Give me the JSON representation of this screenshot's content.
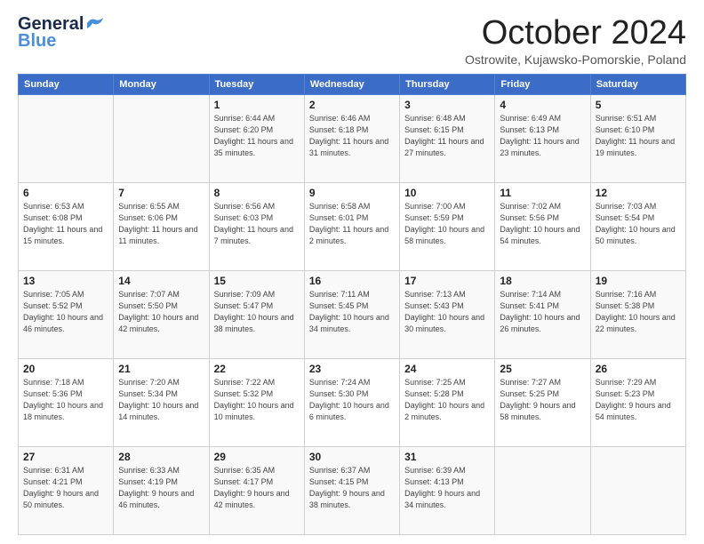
{
  "header": {
    "logo_line1": "General",
    "logo_line2": "Blue",
    "month": "October 2024",
    "location": "Ostrowite, Kujawsko-Pomorskie, Poland"
  },
  "weekdays": [
    "Sunday",
    "Monday",
    "Tuesday",
    "Wednesday",
    "Thursday",
    "Friday",
    "Saturday"
  ],
  "weeks": [
    [
      {
        "day": "",
        "sunrise": "",
        "sunset": "",
        "daylight": ""
      },
      {
        "day": "",
        "sunrise": "",
        "sunset": "",
        "daylight": ""
      },
      {
        "day": "1",
        "sunrise": "Sunrise: 6:44 AM",
        "sunset": "Sunset: 6:20 PM",
        "daylight": "Daylight: 11 hours and 35 minutes."
      },
      {
        "day": "2",
        "sunrise": "Sunrise: 6:46 AM",
        "sunset": "Sunset: 6:18 PM",
        "daylight": "Daylight: 11 hours and 31 minutes."
      },
      {
        "day": "3",
        "sunrise": "Sunrise: 6:48 AM",
        "sunset": "Sunset: 6:15 PM",
        "daylight": "Daylight: 11 hours and 27 minutes."
      },
      {
        "day": "4",
        "sunrise": "Sunrise: 6:49 AM",
        "sunset": "Sunset: 6:13 PM",
        "daylight": "Daylight: 11 hours and 23 minutes."
      },
      {
        "day": "5",
        "sunrise": "Sunrise: 6:51 AM",
        "sunset": "Sunset: 6:10 PM",
        "daylight": "Daylight: 11 hours and 19 minutes."
      }
    ],
    [
      {
        "day": "6",
        "sunrise": "Sunrise: 6:53 AM",
        "sunset": "Sunset: 6:08 PM",
        "daylight": "Daylight: 11 hours and 15 minutes."
      },
      {
        "day": "7",
        "sunrise": "Sunrise: 6:55 AM",
        "sunset": "Sunset: 6:06 PM",
        "daylight": "Daylight: 11 hours and 11 minutes."
      },
      {
        "day": "8",
        "sunrise": "Sunrise: 6:56 AM",
        "sunset": "Sunset: 6:03 PM",
        "daylight": "Daylight: 11 hours and 7 minutes."
      },
      {
        "day": "9",
        "sunrise": "Sunrise: 6:58 AM",
        "sunset": "Sunset: 6:01 PM",
        "daylight": "Daylight: 11 hours and 2 minutes."
      },
      {
        "day": "10",
        "sunrise": "Sunrise: 7:00 AM",
        "sunset": "Sunset: 5:59 PM",
        "daylight": "Daylight: 10 hours and 58 minutes."
      },
      {
        "day": "11",
        "sunrise": "Sunrise: 7:02 AM",
        "sunset": "Sunset: 5:56 PM",
        "daylight": "Daylight: 10 hours and 54 minutes."
      },
      {
        "day": "12",
        "sunrise": "Sunrise: 7:03 AM",
        "sunset": "Sunset: 5:54 PM",
        "daylight": "Daylight: 10 hours and 50 minutes."
      }
    ],
    [
      {
        "day": "13",
        "sunrise": "Sunrise: 7:05 AM",
        "sunset": "Sunset: 5:52 PM",
        "daylight": "Daylight: 10 hours and 46 minutes."
      },
      {
        "day": "14",
        "sunrise": "Sunrise: 7:07 AM",
        "sunset": "Sunset: 5:50 PM",
        "daylight": "Daylight: 10 hours and 42 minutes."
      },
      {
        "day": "15",
        "sunrise": "Sunrise: 7:09 AM",
        "sunset": "Sunset: 5:47 PM",
        "daylight": "Daylight: 10 hours and 38 minutes."
      },
      {
        "day": "16",
        "sunrise": "Sunrise: 7:11 AM",
        "sunset": "Sunset: 5:45 PM",
        "daylight": "Daylight: 10 hours and 34 minutes."
      },
      {
        "day": "17",
        "sunrise": "Sunrise: 7:13 AM",
        "sunset": "Sunset: 5:43 PM",
        "daylight": "Daylight: 10 hours and 30 minutes."
      },
      {
        "day": "18",
        "sunrise": "Sunrise: 7:14 AM",
        "sunset": "Sunset: 5:41 PM",
        "daylight": "Daylight: 10 hours and 26 minutes."
      },
      {
        "day": "19",
        "sunrise": "Sunrise: 7:16 AM",
        "sunset": "Sunset: 5:38 PM",
        "daylight": "Daylight: 10 hours and 22 minutes."
      }
    ],
    [
      {
        "day": "20",
        "sunrise": "Sunrise: 7:18 AM",
        "sunset": "Sunset: 5:36 PM",
        "daylight": "Daylight: 10 hours and 18 minutes."
      },
      {
        "day": "21",
        "sunrise": "Sunrise: 7:20 AM",
        "sunset": "Sunset: 5:34 PM",
        "daylight": "Daylight: 10 hours and 14 minutes."
      },
      {
        "day": "22",
        "sunrise": "Sunrise: 7:22 AM",
        "sunset": "Sunset: 5:32 PM",
        "daylight": "Daylight: 10 hours and 10 minutes."
      },
      {
        "day": "23",
        "sunrise": "Sunrise: 7:24 AM",
        "sunset": "Sunset: 5:30 PM",
        "daylight": "Daylight: 10 hours and 6 minutes."
      },
      {
        "day": "24",
        "sunrise": "Sunrise: 7:25 AM",
        "sunset": "Sunset: 5:28 PM",
        "daylight": "Daylight: 10 hours and 2 minutes."
      },
      {
        "day": "25",
        "sunrise": "Sunrise: 7:27 AM",
        "sunset": "Sunset: 5:25 PM",
        "daylight": "Daylight: 9 hours and 58 minutes."
      },
      {
        "day": "26",
        "sunrise": "Sunrise: 7:29 AM",
        "sunset": "Sunset: 5:23 PM",
        "daylight": "Daylight: 9 hours and 54 minutes."
      }
    ],
    [
      {
        "day": "27",
        "sunrise": "Sunrise: 6:31 AM",
        "sunset": "Sunset: 4:21 PM",
        "daylight": "Daylight: 9 hours and 50 minutes."
      },
      {
        "day": "28",
        "sunrise": "Sunrise: 6:33 AM",
        "sunset": "Sunset: 4:19 PM",
        "daylight": "Daylight: 9 hours and 46 minutes."
      },
      {
        "day": "29",
        "sunrise": "Sunrise: 6:35 AM",
        "sunset": "Sunset: 4:17 PM",
        "daylight": "Daylight: 9 hours and 42 minutes."
      },
      {
        "day": "30",
        "sunrise": "Sunrise: 6:37 AM",
        "sunset": "Sunset: 4:15 PM",
        "daylight": "Daylight: 9 hours and 38 minutes."
      },
      {
        "day": "31",
        "sunrise": "Sunrise: 6:39 AM",
        "sunset": "Sunset: 4:13 PM",
        "daylight": "Daylight: 9 hours and 34 minutes."
      },
      {
        "day": "",
        "sunrise": "",
        "sunset": "",
        "daylight": ""
      },
      {
        "day": "",
        "sunrise": "",
        "sunset": "",
        "daylight": ""
      }
    ]
  ]
}
